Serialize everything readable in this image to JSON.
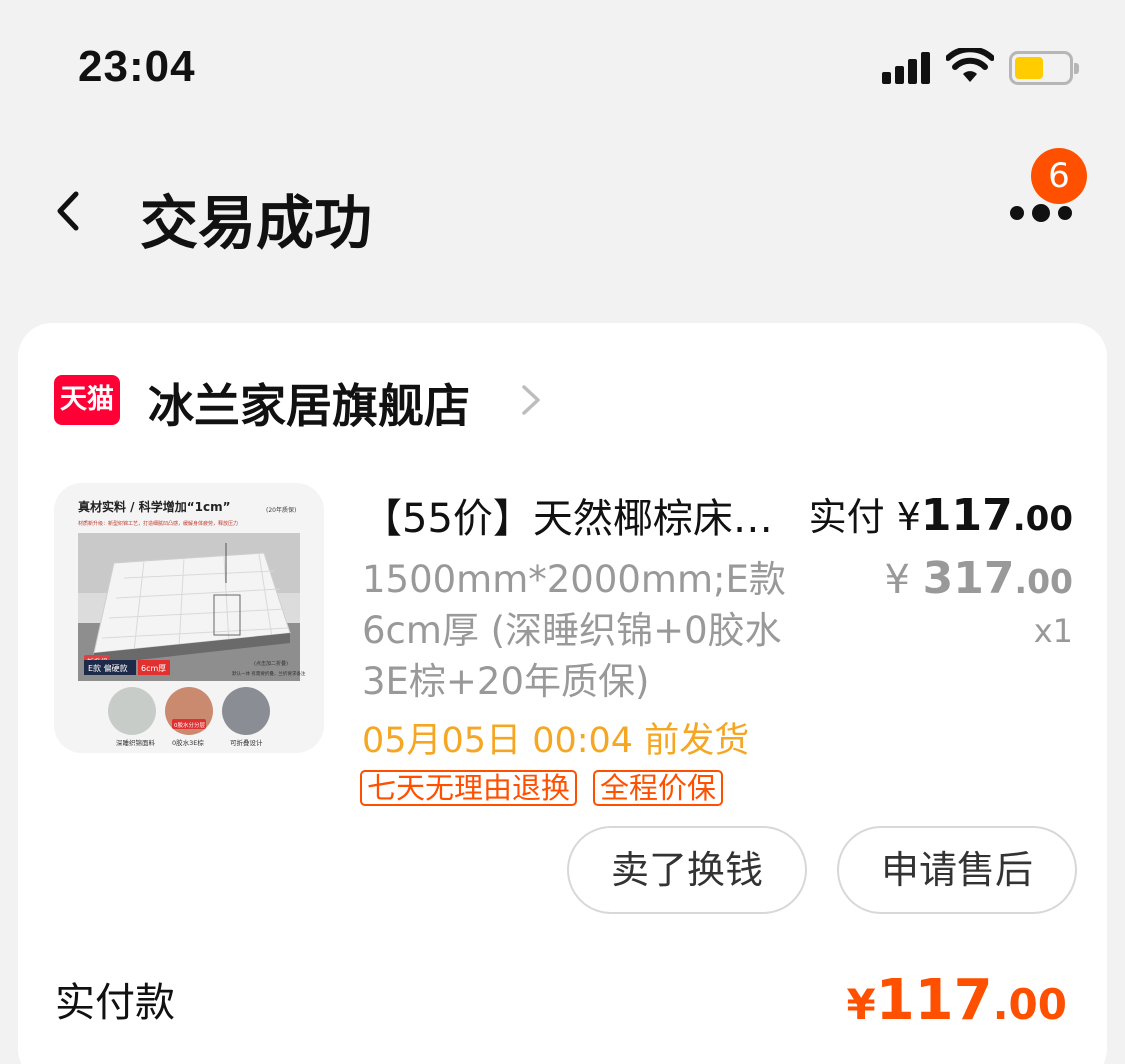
{
  "status_bar": {
    "time": "23:04"
  },
  "nav": {
    "title": "交易成功",
    "more_badge": "6"
  },
  "store": {
    "badge": "天猫",
    "name": "冰兰家居旗舰店"
  },
  "product": {
    "title": "【55价】天然椰棕床…",
    "sku": "1500mm*2000mm;E款 6cm厚 (深睡织锦+0胶水 3E棕+20年质保)",
    "shipping": "05月05日 00:04 前发货",
    "tags": [
      "七天无理由退换",
      "全程价保"
    ],
    "paid_label": "实付",
    "currency": "¥",
    "paid_int": "117",
    "paid_dec": ".00",
    "orig_int": "317",
    "orig_dec": ".00",
    "qty": "x1",
    "image_text": {
      "headline": "真材实料 / 科学增加“1cm”",
      "headline_note": "(20年质保)",
      "subline": "材质新升级：新型织锦工艺，打造细腻凹凸感，缓解身体疲劳，释放压力",
      "new_badge": "新升级",
      "model_label": "E款 偏硬款",
      "thickness_label": "6cm厚",
      "side_note": "(点击加二折叠)",
      "bottom_note": "默认一体 有需要折叠，兰折要求备注",
      "features": [
        "深睡织锦面料",
        "0胶水3E棕",
        "可折叠设计"
      ],
      "feature_tag": "0胶水分分层"
    }
  },
  "actions": {
    "sell": "卖了换钱",
    "after_sale": "申请售后"
  },
  "total": {
    "label": "实付款",
    "currency": "¥",
    "int": "117",
    "dec": ".00"
  },
  "colors": {
    "accent": "#ff5000",
    "shipping": "#f5a623",
    "tmall": "#ff0036"
  }
}
